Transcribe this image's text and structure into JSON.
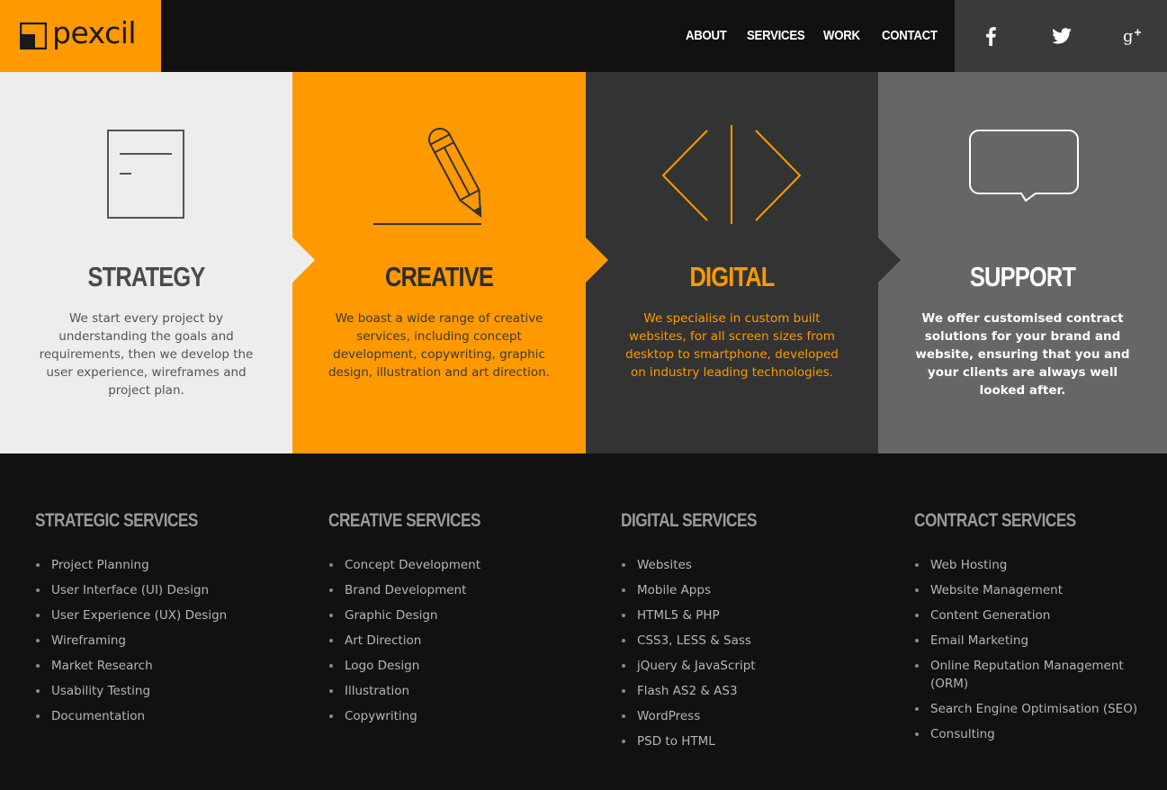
{
  "header": {
    "logo_text": "pexcil",
    "nav": [
      "ABOUT",
      "SERVICES",
      "WORK",
      "CONTACT"
    ],
    "social": [
      {
        "icon": "facebook-icon",
        "label": "f"
      },
      {
        "icon": "twitter-icon",
        "label": "twitter"
      },
      {
        "icon": "google-plus-icon",
        "label": "g+"
      }
    ]
  },
  "colors": {
    "accent": "#ff9900",
    "dark": "#111111",
    "panel_light": "#ededed",
    "panel_dark": "#333333",
    "panel_grey": "#666666"
  },
  "panels": [
    {
      "icon": "document-icon",
      "title": "STRATEGY",
      "text": "We start every project by understanding the goals and requirements, then we develop the user experience, wireframes and project plan."
    },
    {
      "icon": "pencil-icon",
      "title": "CREATIVE",
      "text": "We boast a wide range of creative services, including concept development, copywriting, graphic design, illustration and art direction."
    },
    {
      "icon": "code-brackets-icon",
      "title": "DIGITAL",
      "text": "We specialise in custom built websites, for all screen sizes from desktop to smartphone, developed on industry leading technologies."
    },
    {
      "icon": "speech-bubble-icon",
      "title": "SUPPORT",
      "text": "We offer customised contract solutions for your brand and website, ensuring that you and your clients are always well looked after."
    }
  ],
  "services": [
    {
      "heading": "STRATEGIC SERVICES",
      "items": [
        "Project Planning",
        "User Interface (UI) Design",
        "User Experience (UX) Design",
        "Wireframing",
        "Market Research",
        "Usability Testing",
        "Documentation"
      ]
    },
    {
      "heading": "CREATIVE SERVICES",
      "items": [
        "Concept Development",
        "Brand Development",
        "Graphic Design",
        "Art Direction",
        "Logo Design",
        "Illustration",
        "Copywriting"
      ]
    },
    {
      "heading": "DIGITAL SERVICES",
      "items": [
        "Websites",
        "Mobile Apps",
        "HTML5 & PHP",
        "CSS3, LESS & Sass",
        "jQuery & JavaScript",
        "Flash AS2 & AS3",
        "WordPress",
        "PSD to HTML"
      ]
    },
    {
      "heading": "CONTRACT SERVICES",
      "items": [
        "Web Hosting",
        "Website Management",
        "Content Generation",
        "Email Marketing",
        "Online Reputation Management (ORM)",
        "Search Engine Optimisation (SEO)",
        "Consulting"
      ]
    }
  ]
}
